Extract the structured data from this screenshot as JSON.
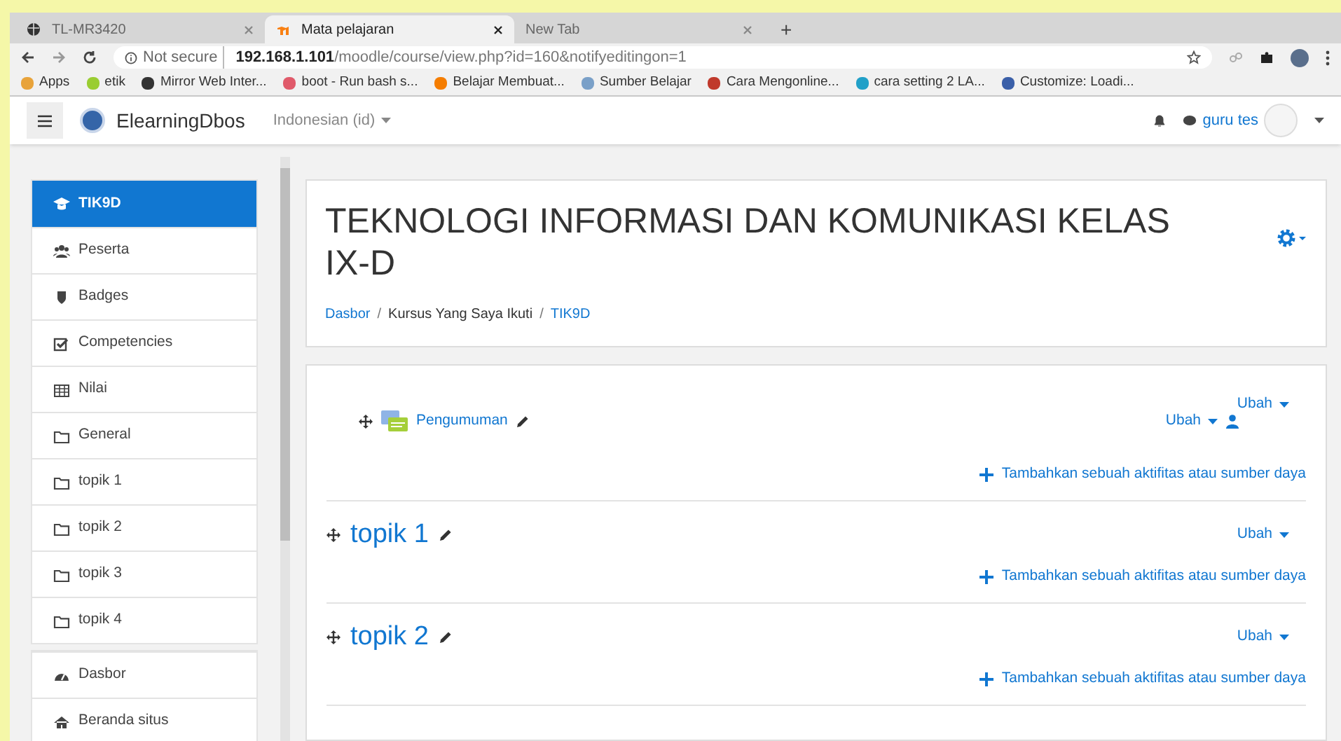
{
  "browser": {
    "tabs": [
      {
        "title": "TL-MR3420",
        "kind": "globe",
        "selected": false
      },
      {
        "title": "Mata pelajaran",
        "kind": "moodle",
        "selected": true
      },
      {
        "title": "New Tab",
        "kind": "blank",
        "selected": false
      }
    ],
    "new_tab": "+",
    "address": {
      "security": "Not secure",
      "host": "192.168.1.101",
      "path": "/moodle/course/view.php?id=160&notifyeditingon=1"
    },
    "bookmarks": [
      {
        "label": "Apps",
        "color": "#e8a33a"
      },
      {
        "label": "etik",
        "color": "#9acd32"
      },
      {
        "label": "Mirror Web Inter...",
        "color": "#333333"
      },
      {
        "label": "boot - Run bash s...",
        "color": "#e05a6a"
      },
      {
        "label": "Belajar Membuat...",
        "color": "#f57d00"
      },
      {
        "label": "Sumber Belajar",
        "color": "#7aa0c8"
      },
      {
        "label": "Cara Mengonline...",
        "color": "#c0392b"
      },
      {
        "label": "cara setting 2 LA...",
        "color": "#21a0c8"
      },
      {
        "label": "Customize: Loadi...",
        "color": "#3a5fa8"
      }
    ]
  },
  "navbar": {
    "site_name": "ElearningDbos",
    "language": "Indonesian (id)",
    "user": "guru tes"
  },
  "sidebar": {
    "groups": [
      [
        {
          "label": "TIK9D",
          "kind": "cap",
          "selected": true
        },
        {
          "label": "Peserta",
          "kind": "users",
          "selected": false
        },
        {
          "label": "Badges",
          "kind": "shield",
          "selected": false
        },
        {
          "label": "Competencies",
          "kind": "check",
          "selected": false
        },
        {
          "label": "Nilai",
          "kind": "table",
          "selected": false
        },
        {
          "label": "General",
          "kind": "folder",
          "selected": false
        },
        {
          "label": "topik 1",
          "kind": "folder",
          "selected": false
        },
        {
          "label": "topik 2",
          "kind": "folder",
          "selected": false
        },
        {
          "label": "topik 3",
          "kind": "folder",
          "selected": false
        },
        {
          "label": "topik 4",
          "kind": "folder",
          "selected": false
        }
      ],
      [
        {
          "label": "Dasbor",
          "kind": "gauge",
          "selected": false
        },
        {
          "label": "Beranda situs",
          "kind": "home",
          "selected": false
        }
      ]
    ]
  },
  "course": {
    "title": "TEKNOLOGI INFORMASI DAN KOMUNIKASI KELAS IX-D",
    "breadcrumb": [
      {
        "label": "Dasbor",
        "kind": "link"
      },
      {
        "separator": "/",
        "label": "Kursus Yang Saya Ikuti",
        "kind": "text"
      },
      {
        "separator": "/",
        "label": "TIK9D",
        "kind": "link"
      }
    ]
  },
  "sections": [
    {
      "menu": "Ubah",
      "activities": [
        {
          "name": "Pengumuman",
          "menu": "Ubah"
        }
      ],
      "add": "Tambahkan sebuah aktifitas atau sumber daya"
    },
    {
      "title": "topik 1",
      "menu": "Ubah",
      "add": "Tambahkan sebuah aktifitas atau sumber daya"
    },
    {
      "title": "topik 2",
      "menu": "Ubah",
      "add": "Tambahkan sebuah aktifitas atau sumber daya"
    }
  ]
}
